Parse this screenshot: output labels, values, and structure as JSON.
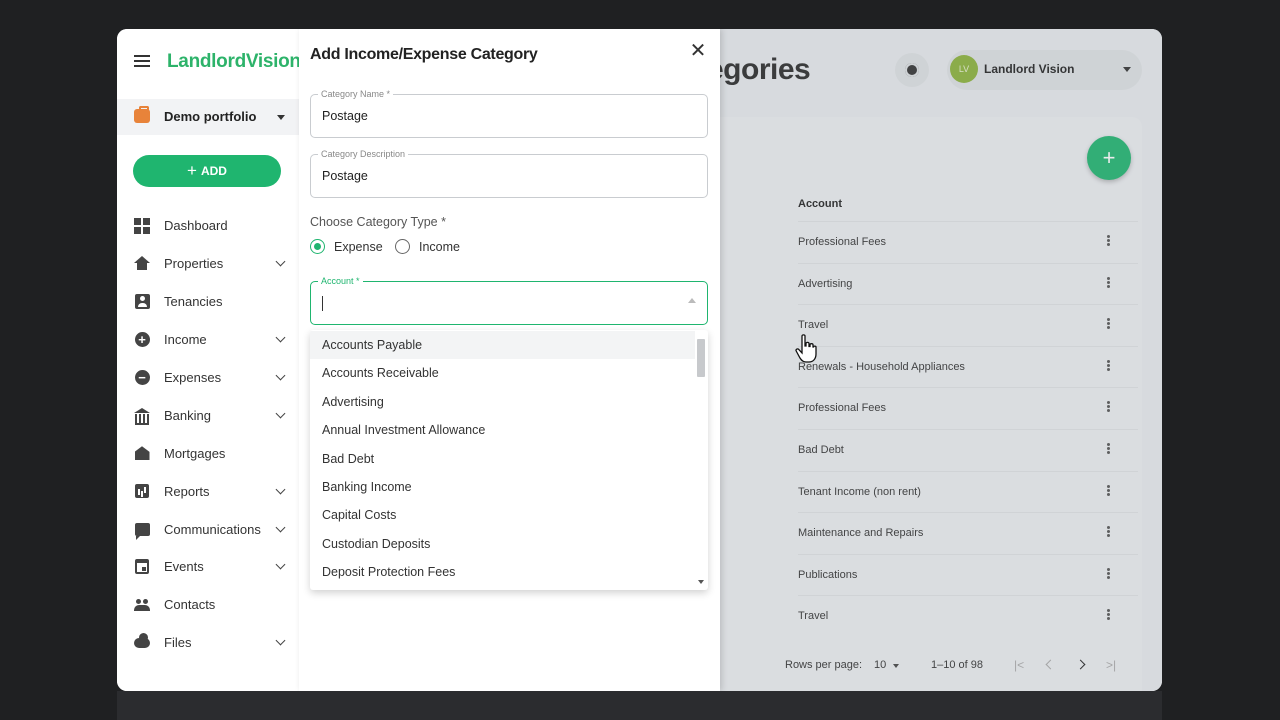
{
  "app": {
    "logo_text": "LandlordVision"
  },
  "sidebar": {
    "portfolio": "Demo portfolio",
    "add_label": "ADD",
    "items": [
      {
        "label": "Dashboard",
        "icon": "dashboard-icon",
        "expandable": false
      },
      {
        "label": "Properties",
        "icon": "home-icon",
        "expandable": true
      },
      {
        "label": "Tenancies",
        "icon": "person-card-icon",
        "expandable": false
      },
      {
        "label": "Income",
        "icon": "plus-circle-icon",
        "expandable": true
      },
      {
        "label": "Expenses",
        "icon": "minus-circle-icon",
        "expandable": true
      },
      {
        "label": "Banking",
        "icon": "bank-icon",
        "expandable": true
      },
      {
        "label": "Mortgages",
        "icon": "house-money-icon",
        "expandable": false
      },
      {
        "label": "Reports",
        "icon": "bar-chart-icon",
        "expandable": true
      },
      {
        "label": "Communications",
        "icon": "chat-icon",
        "expandable": true
      },
      {
        "label": "Events",
        "icon": "calendar-icon",
        "expandable": true
      },
      {
        "label": "Contacts",
        "icon": "people-icon",
        "expandable": false
      },
      {
        "label": "Files",
        "icon": "cloud-icon",
        "expandable": true
      }
    ]
  },
  "header": {
    "title_fragment": "egories",
    "user_initials": "LV",
    "user_name": "Landlord Vision"
  },
  "table": {
    "column_header": "Account",
    "rows": [
      "Professional Fees",
      "Advertising",
      "Travel",
      "Renewals - Household Appliances",
      "Professional Fees",
      "Bad Debt",
      "Tenant Income (non rent)",
      "Maintenance and Repairs",
      "Publications",
      "Travel"
    ],
    "rows_per_page_label": "Rows per page:",
    "rows_per_page_value": "10",
    "range_text": "1–10 of 98"
  },
  "dialog": {
    "title": "Add Income/Expense Category",
    "category_name_label": "Category Name *",
    "category_name_value": "Postage",
    "category_description_label": "Category Description",
    "category_description_value": "Postage",
    "category_type_label": "Choose Category Type *",
    "type_options": [
      {
        "label": "Expense",
        "selected": true
      },
      {
        "label": "Income",
        "selected": false
      }
    ],
    "account_label": "Account *",
    "account_value": "",
    "account_options": [
      "Accounts Payable",
      "Accounts Receivable",
      "Advertising",
      "Annual Investment Allowance",
      "Bad Debt",
      "Banking Income",
      "Capital Costs",
      "Custodian Deposits",
      "Deposit Protection Fees"
    ]
  },
  "colors": {
    "brand_green": "#1fb56f",
    "logo_green": "#2db36a",
    "portfolio_orange": "#e8833a",
    "avatar_olive": "#8bb33a"
  }
}
